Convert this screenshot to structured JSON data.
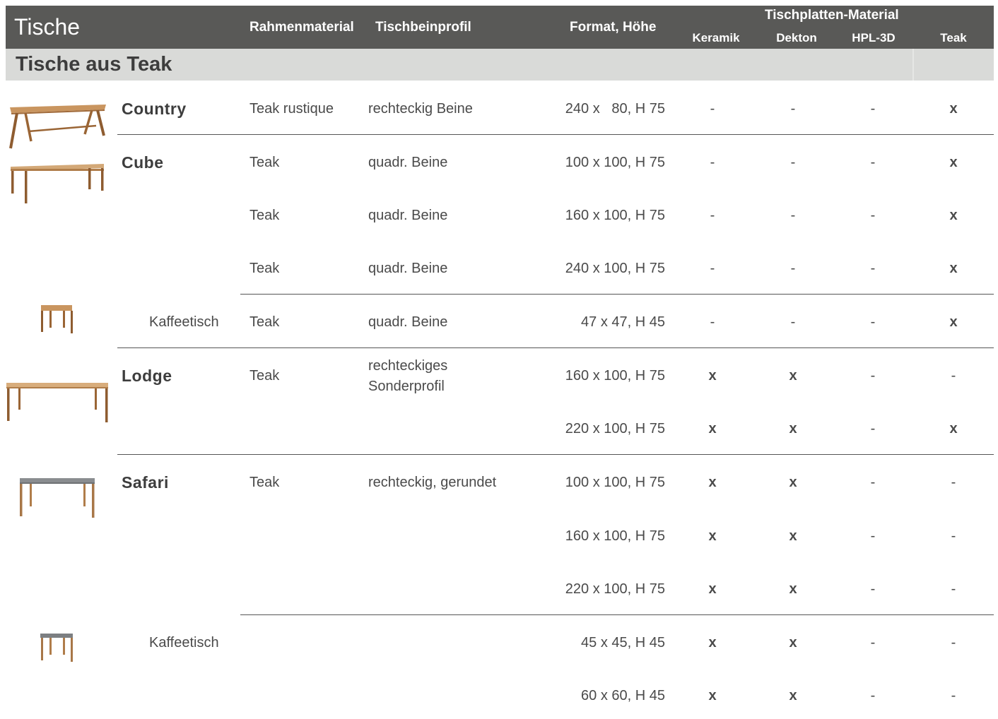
{
  "header": {
    "title": "Tische",
    "col_rahmen": "Rahmenmaterial",
    "col_profil": "Tischbeinprofil",
    "col_format": "Format, Höhe",
    "col_platten": "Tischplatten-Material",
    "sub_keramik": "Keramik",
    "sub_dekton": "Dekton",
    "sub_hpl": "HPL-3D",
    "sub_teak": "Teak"
  },
  "section": {
    "title": "Tische aus Teak"
  },
  "colors": {
    "header_bg": "#595957",
    "section_bg": "#d9dad8",
    "teak": "#b07d4a",
    "glass": "#7c7f82"
  },
  "rows": [
    {
      "name": "Country",
      "rahmen": "Teak rustique",
      "profil": "rechteckig Beine",
      "format": "240 x   80, H 75",
      "keramik": "-",
      "dekton": "-",
      "hpl": "-",
      "teak": "x"
    },
    {
      "name": "Cube",
      "rahmen": "Teak",
      "profil": "quadr. Beine",
      "format": "100 x 100, H 75",
      "keramik": "-",
      "dekton": "-",
      "hpl": "-",
      "teak": "x"
    },
    {
      "rahmen": "Teak",
      "profil": "quadr. Beine",
      "format": "160 x 100, H 75",
      "keramik": "-",
      "dekton": "-",
      "hpl": "-",
      "teak": "x"
    },
    {
      "rahmen": "Teak",
      "profil": "quadr. Beine",
      "format": "240 x 100, H 75",
      "keramik": "-",
      "dekton": "-",
      "hpl": "-",
      "teak": "x"
    },
    {
      "subname": "Kaffeetisch",
      "rahmen": "Teak",
      "profil": "quadr. Beine",
      "format": "47 x 47, H 45",
      "keramik": "-",
      "dekton": "-",
      "hpl": "-",
      "teak": "x"
    },
    {
      "name": "Lodge",
      "rahmen": "Teak",
      "profil_line1": "rechteckiges",
      "profil_line2": "Sonderprofil",
      "format": "160 x 100, H 75",
      "keramik": "x",
      "dekton": "x",
      "hpl": "-",
      "teak": "-"
    },
    {
      "format": "220 x 100, H 75",
      "keramik": "x",
      "dekton": "x",
      "hpl": "-",
      "teak": "x"
    },
    {
      "name": "Safari",
      "rahmen": "Teak",
      "profil": "rechteckig, gerundet",
      "format": "100 x 100, H 75",
      "keramik": "x",
      "dekton": "x",
      "hpl": "-",
      "teak": "-"
    },
    {
      "format": "160 x 100, H 75",
      "keramik": "x",
      "dekton": "x",
      "hpl": "-",
      "teak": "-"
    },
    {
      "format": "220 x 100, H 75",
      "keramik": "x",
      "dekton": "x",
      "hpl": "-",
      "teak": "-"
    },
    {
      "subname": "Kaffeetisch",
      "format": "45 x 45, H 45",
      "keramik": "x",
      "dekton": "x",
      "hpl": "-",
      "teak": "-"
    },
    {
      "format": "60 x 60, H 45",
      "keramik": "x",
      "dekton": "x",
      "hpl": "-",
      "teak": "-"
    }
  ]
}
